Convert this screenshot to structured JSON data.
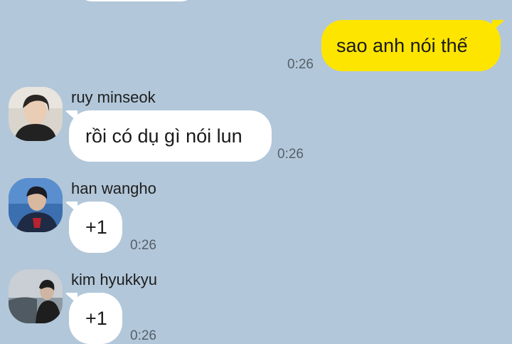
{
  "chat": {
    "messages": [
      {
        "from_me": true,
        "text": "sao anh nói thế",
        "time": "0:26"
      },
      {
        "sender": "ruy minseok",
        "text": "rồi có dụ gì nói lun",
        "time": "0:26",
        "avatar_icon": "person-photo-icon"
      },
      {
        "sender": "han wangho",
        "text": "+1",
        "time": "0:26",
        "avatar_icon": "person-photo-icon"
      },
      {
        "sender": "kim hyukkyu",
        "text": "+1",
        "time": "0:26",
        "avatar_icon": "person-photo-icon"
      }
    ]
  },
  "colors": {
    "background": "#b2c7d9",
    "my_bubble": "#fee500",
    "other_bubble": "#ffffff",
    "time_text": "#55606b"
  }
}
